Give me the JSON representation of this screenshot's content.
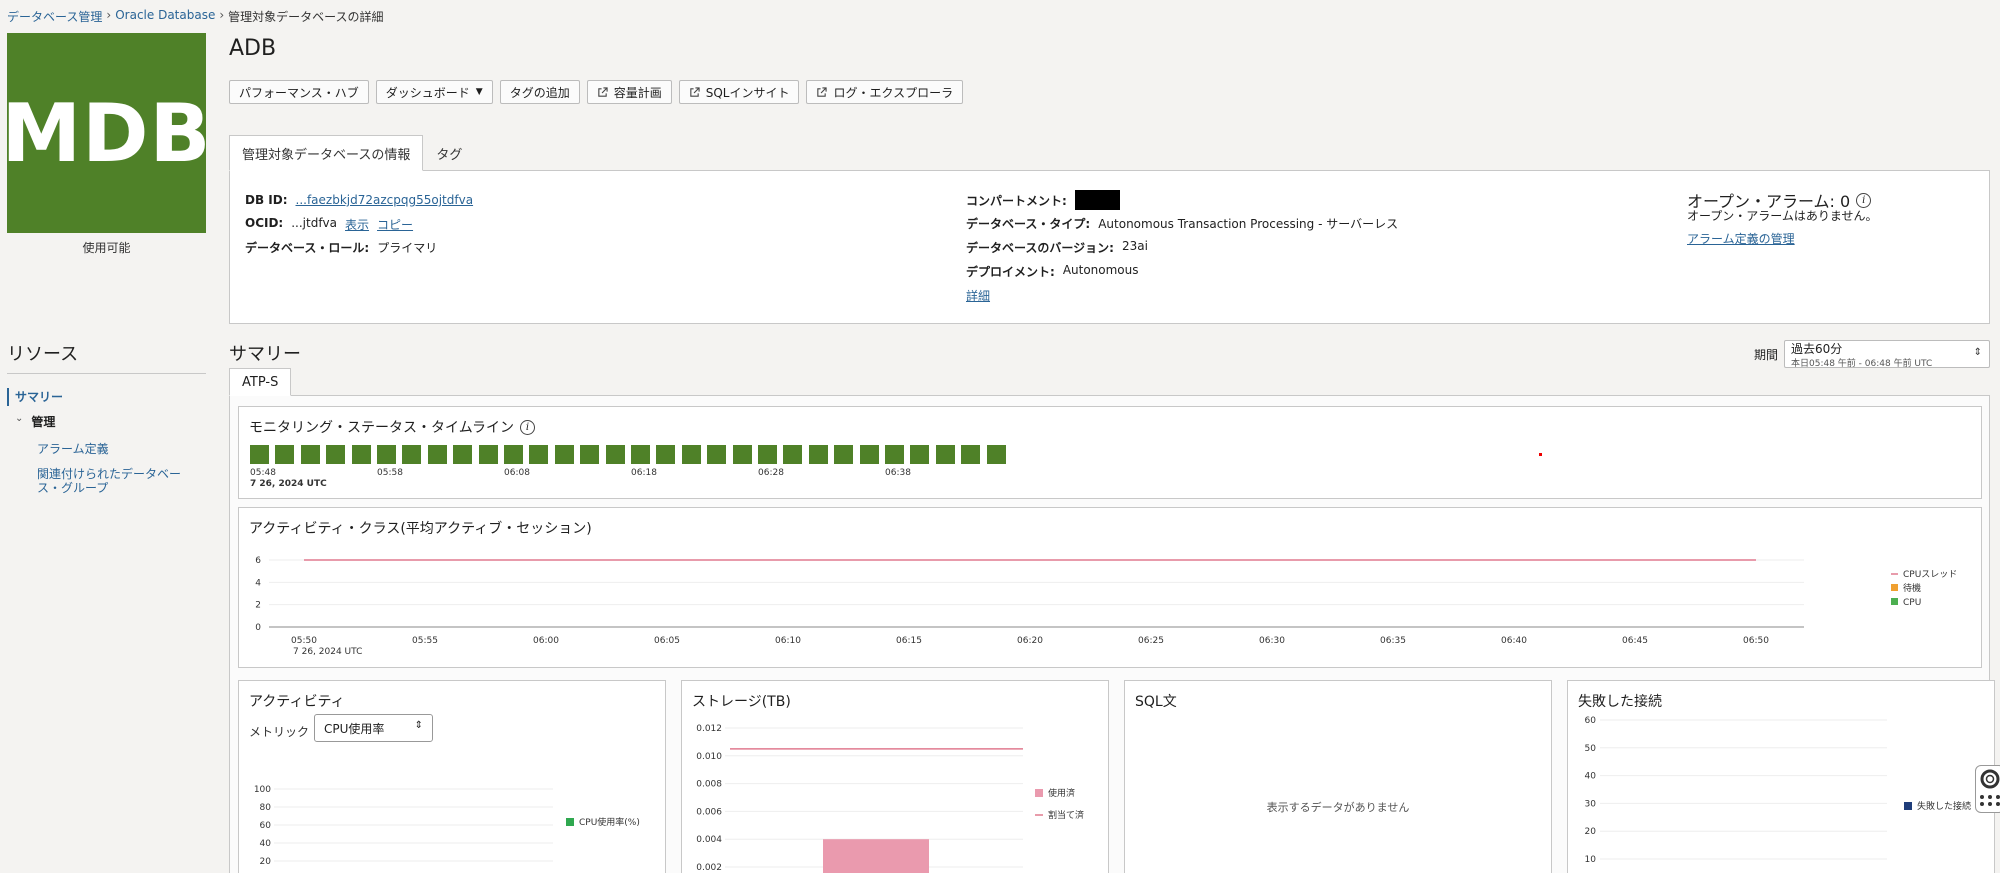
{
  "breadcrumb": {
    "items": [
      "データベース管理",
      "Oracle Database",
      "管理対象データベースの詳細"
    ],
    "separator": "›"
  },
  "logo": {
    "text": "MDB",
    "status": "使用可能",
    "color": "#4f8128"
  },
  "title": "ADB",
  "actions": {
    "performance_hub": "パフォーマンス・ハブ",
    "dashboard": "ダッシュボード",
    "add_tag": "タグの追加",
    "capacity_plan": "容量計画",
    "sql_insight": "SQLインサイト",
    "log_explorer": "ログ・エクスプローラ"
  },
  "info_tabs": [
    "管理対象データベースの情報",
    "タグ"
  ],
  "info": {
    "db_id_label": "DB ID:",
    "db_id_value": "...faezbkjd72azcpqg55ojtdfva",
    "ocid_label": "OCID:",
    "ocid_value": "...jtdfva",
    "show_link": "表示",
    "copy_link": "コピー",
    "role_label": "データベース・ロール:",
    "role_value": "プライマリ",
    "compartment_label": "コンパートメント:",
    "db_type_label": "データベース・タイプ:",
    "db_type_value": "Autonomous Transaction Processing - サーバーレス",
    "db_version_label": "データベースのバージョン:",
    "db_version_value": "23ai",
    "deployment_label": "デプロイメント:",
    "deployment_value": "Autonomous",
    "details_link": "詳細",
    "open_alarms_title": "オープン・アラーム: 0",
    "no_alarms": "オープン・アラームはありません。",
    "manage_alarms_link": "アラーム定義の管理"
  },
  "resources": {
    "title": "リソース",
    "summary": "サマリー",
    "management": "管理",
    "alarm_definitions": "アラーム定義",
    "related_group_line1": "関連付けられたデータベー",
    "related_group_line2": "ス・グループ"
  },
  "summary": {
    "title": "サマリー",
    "period_label": "期間",
    "period_value": "過去60分",
    "period_sub": "本日05:48 午前 - 06:48 午前 UTC",
    "tab": "ATP-S"
  },
  "timeline": {
    "title": "モニタリング・ステータス・タイムライン",
    "block_count": 30,
    "block_color": "#4f8128",
    "labels": [
      "05:48",
      "05:58",
      "06:08",
      "06:18",
      "06:28",
      "06:38"
    ],
    "date": "7 26, 2024 UTC"
  },
  "colors": {
    "cpu_threads": "#e07a8f",
    "wait": "#f0a030",
    "cpu": "#4caf50",
    "cpu_usage": "#2fa84f",
    "used": "#ea9aae",
    "allocated": "#e07a8f",
    "failed": "#1f3d7a"
  },
  "chart_data": [
    {
      "type": "line",
      "title": "アクティビティ・クラス(平均アクティブ・セッション)",
      "x": [
        "05:50",
        "05:55",
        "06:00",
        "06:05",
        "06:10",
        "06:15",
        "06:20",
        "06:25",
        "06:30",
        "06:35",
        "06:40",
        "06:45",
        "06:50"
      ],
      "x_sublabel": "7 26, 2024 UTC",
      "yticks": [
        0,
        2,
        4,
        6
      ],
      "ylim": [
        0,
        6
      ],
      "series": [
        {
          "name": "CPUスレッド",
          "values": [
            6,
            6,
            6,
            6,
            6,
            6,
            6,
            6,
            6,
            6,
            6,
            6,
            6
          ]
        },
        {
          "name": "待機",
          "values": []
        },
        {
          "name": "CPU",
          "values": []
        }
      ],
      "legend": "right"
    },
    {
      "type": "area",
      "title": "アクティビティ",
      "metric_label": "メトリック",
      "metric_value": "CPU使用率",
      "yticks": [
        20,
        40,
        60,
        80,
        100
      ],
      "series": [
        {
          "name": "CPU使用率(%)",
          "values": []
        }
      ],
      "legend": "right"
    },
    {
      "type": "bar",
      "title": "ストレージ(TB)",
      "yticks": [
        0.002,
        0.004,
        0.006,
        0.008,
        0.01,
        0.012
      ],
      "series": [
        {
          "name": "使用済",
          "values": [
            0.004
          ]
        },
        {
          "name": "割当て済",
          "values": [
            0.0105
          ]
        }
      ],
      "legend": "right"
    },
    {
      "type": "table",
      "title": "SQL文",
      "empty_message": "表示するデータがありません"
    },
    {
      "type": "line",
      "title": "失敗した接続",
      "yticks": [
        10,
        20,
        30,
        40,
        50,
        60
      ],
      "series": [
        {
          "name": "失敗した接続",
          "values": []
        }
      ],
      "legend": "right"
    }
  ]
}
